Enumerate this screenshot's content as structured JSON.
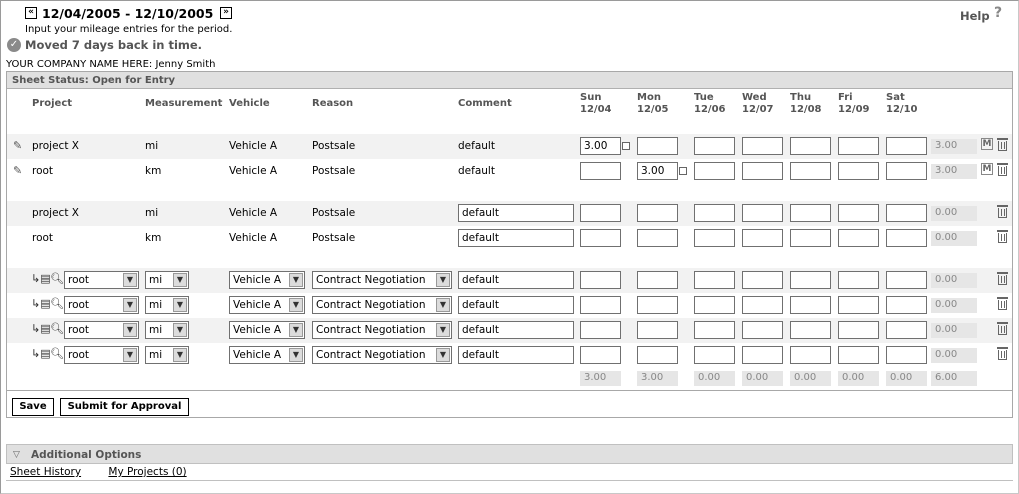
{
  "header": {
    "period": "12/04/2005 - 12/10/2005",
    "prev_glyph": "«",
    "next_glyph": "»",
    "instructions": "Input your mileage entries for the period.",
    "message": "Moved 7 days back in time.",
    "help_label": "Help",
    "help_glyph": "?",
    "company": "YOUR COMPANY NAME HERE: Jenny Smith"
  },
  "sheet": {
    "status": "Sheet Status: Open for Entry",
    "columns": {
      "project": "Project",
      "measurement": "Measurement",
      "vehicle": "Vehicle",
      "reason": "Reason",
      "comment": "Comment"
    },
    "days": [
      {
        "dow": "Sun",
        "date": "12/04"
      },
      {
        "dow": "Mon",
        "date": "12/05"
      },
      {
        "dow": "Tue",
        "date": "12/06"
      },
      {
        "dow": "Wed",
        "date": "12/07"
      },
      {
        "dow": "Thu",
        "date": "12/08"
      },
      {
        "dow": "Fri",
        "date": "12/09"
      },
      {
        "dow": "Sat",
        "date": "12/10"
      }
    ],
    "approved_rows": [
      {
        "project": "project X",
        "measurement": "mi",
        "vehicle": "Vehicle A",
        "reason": "Postsale",
        "comment": "default",
        "values": [
          "3.00",
          "",
          "",
          "",
          "",
          "",
          ""
        ],
        "total": "3.00",
        "badge": "M"
      },
      {
        "project": "root",
        "measurement": "km",
        "vehicle": "Vehicle A",
        "reason": "Postsale",
        "comment": "default",
        "values": [
          "",
          "3.00",
          "",
          "",
          "",
          "",
          ""
        ],
        "total": "3.00",
        "badge": "M"
      }
    ],
    "entry_rows": [
      {
        "project": "project X",
        "measurement": "mi",
        "vehicle": "Vehicle A",
        "reason": "Postsale",
        "comment": "default",
        "values": [
          "",
          "",
          "",
          "",
          "",
          "",
          ""
        ],
        "total": "0.00"
      },
      {
        "project": "root",
        "measurement": "km",
        "vehicle": "Vehicle A",
        "reason": "Postsale",
        "comment": "default",
        "values": [
          "",
          "",
          "",
          "",
          "",
          "",
          ""
        ],
        "total": "0.00"
      }
    ],
    "new_rows": [
      {
        "project": "root",
        "measurement": "mi",
        "vehicle": "Vehicle A",
        "reason": "Contract Negotiation",
        "comment": "default",
        "values": [
          "",
          "",
          "",
          "",
          "",
          "",
          ""
        ],
        "total": "0.00"
      },
      {
        "project": "root",
        "measurement": "mi",
        "vehicle": "Vehicle A",
        "reason": "Contract Negotiation",
        "comment": "default",
        "values": [
          "",
          "",
          "",
          "",
          "",
          "",
          ""
        ],
        "total": "0.00"
      },
      {
        "project": "root",
        "measurement": "mi",
        "vehicle": "Vehicle A",
        "reason": "Contract Negotiation",
        "comment": "default",
        "values": [
          "",
          "",
          "",
          "",
          "",
          "",
          ""
        ],
        "total": "0.00"
      },
      {
        "project": "root",
        "measurement": "mi",
        "vehicle": "Vehicle A",
        "reason": "Contract Negotiation",
        "comment": "default",
        "values": [
          "",
          "",
          "",
          "",
          "",
          "",
          ""
        ],
        "total": "0.00"
      }
    ],
    "day_totals": [
      "3.00",
      "3.00",
      "0.00",
      "0.00",
      "0.00",
      "0.00",
      "0.00"
    ],
    "grand_total": "6.00",
    "buttons": {
      "save": "Save",
      "submit": "Submit for Approval"
    }
  },
  "additional": {
    "title": "Additional Options",
    "links": [
      "Sheet History",
      "My Projects (0)"
    ]
  },
  "icons": {
    "edit": "pencil-icon",
    "delete": "trash-icon",
    "ok": "check-circle-icon",
    "search": "magnifier-icon",
    "copy": "copy-row-icon"
  }
}
